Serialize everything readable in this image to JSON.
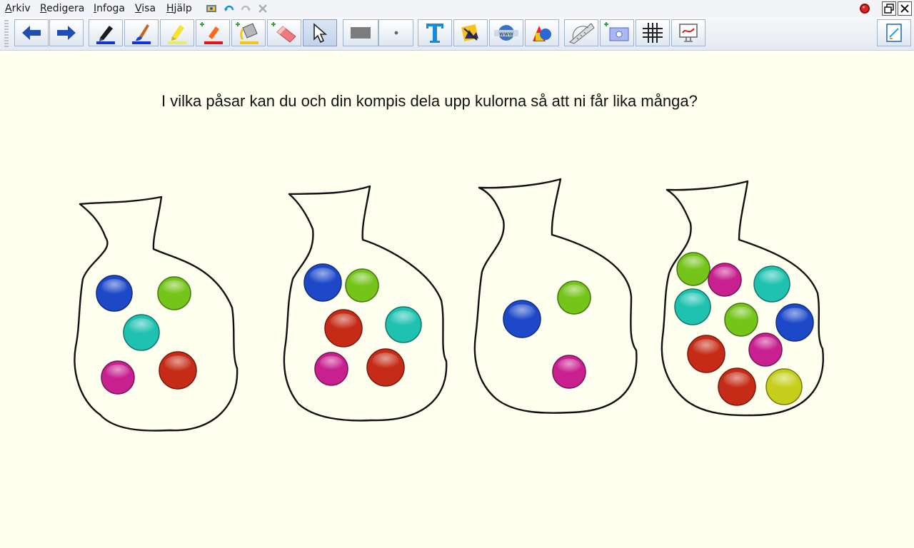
{
  "menu": {
    "items": [
      {
        "name": "menu-arkiv",
        "label": "Arkiv"
      },
      {
        "name": "menu-redigera",
        "label": "Redigera"
      },
      {
        "name": "menu-infoga",
        "label": "Infoga"
      },
      {
        "name": "menu-visa",
        "label": "Visa"
      },
      {
        "name": "menu-hjalp",
        "label": "Hjälp"
      }
    ]
  },
  "toolbar": {
    "tools": [
      "back-arrow",
      "forward-arrow",
      "marker-pen",
      "brush-pen",
      "highlighter",
      "add-pen",
      "fill-bucket",
      "eraser",
      "select-pointer",
      "rectangle-color",
      "point-size",
      "insert-text",
      "insert-image",
      "insert-web",
      "insert-shape",
      "protractor",
      "add-screen-capture",
      "grid",
      "screen-shade",
      "side-panel"
    ]
  },
  "colors": {
    "blue": "#1d49c9",
    "green": "#74c41a",
    "cyan": "#1fc2b0",
    "red": "#c52b16",
    "magenta": "#c8218f",
    "yellow": "#c7cf1d",
    "canvas": "#ffffef"
  },
  "canvas": {
    "question": "I vilka påsar kan du och din kompis dela upp kulorna så att ni får lika många?"
  },
  "bags": [
    {
      "name": "bag-1",
      "marbles": [
        "blue",
        "green",
        "cyan",
        "magenta",
        "red"
      ]
    },
    {
      "name": "bag-2",
      "marbles": [
        "blue",
        "green",
        "red",
        "cyan",
        "magenta",
        "red"
      ]
    },
    {
      "name": "bag-3",
      "marbles": [
        "green",
        "blue",
        "magenta"
      ]
    },
    {
      "name": "bag-4",
      "marbles": [
        "green",
        "magenta",
        "cyan",
        "cyan",
        "green",
        "blue",
        "red",
        "magenta",
        "red",
        "yellow"
      ]
    }
  ]
}
